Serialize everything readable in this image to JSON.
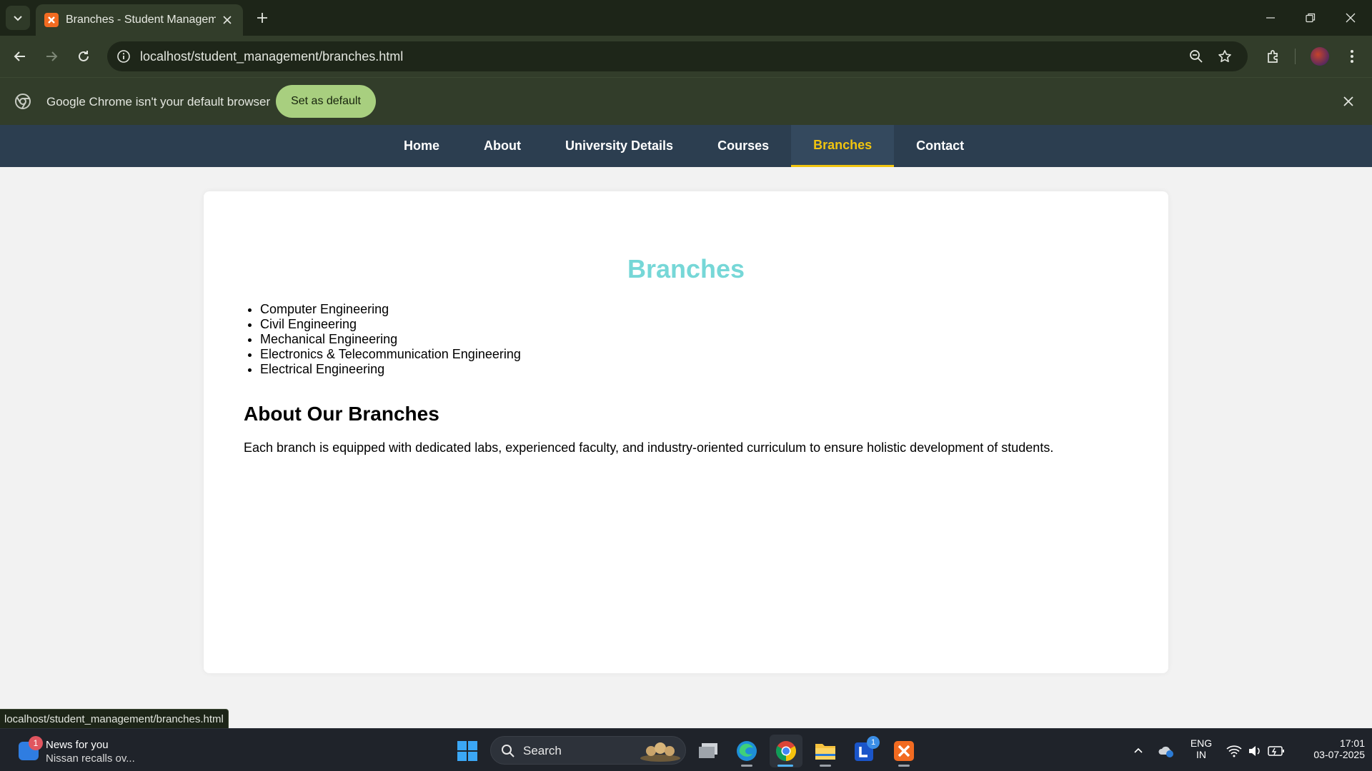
{
  "browser": {
    "tab_title": "Branches - Student Management",
    "url": "localhost/student_management/branches.html",
    "infobar_text": "Google Chrome isn't your default browser",
    "set_default_label": "Set as default",
    "status_url": "localhost/student_management/branches.html"
  },
  "site_nav": {
    "items": [
      {
        "label": "Home"
      },
      {
        "label": "About"
      },
      {
        "label": "University Details"
      },
      {
        "label": "Courses"
      },
      {
        "label": "Branches"
      },
      {
        "label": "Contact"
      }
    ],
    "active_index": 4
  },
  "content": {
    "title": "Branches",
    "branches": [
      "Computer Engineering",
      "Civil Engineering",
      "Mechanical Engineering",
      "Electronics & Telecommunication Engineering",
      "Electrical Engineering"
    ],
    "about_heading": "About Our Branches",
    "about_text": "Each branch is equipped with dedicated labs, experienced faculty, and industry-oriented curriculum to ensure holistic development of students."
  },
  "taskbar": {
    "news_title": "News for you",
    "news_sub": "Nissan recalls ov...",
    "news_badge": "1",
    "search_label": "Search",
    "app_badge": "1",
    "lang_top": "ENG",
    "lang_bottom": "IN",
    "time": "17:01",
    "date": "03-07-2025"
  },
  "colors": {
    "nav_bg": "#2c3e50",
    "nav_active": "#f1c40f",
    "title_color": "#76d7d7"
  }
}
